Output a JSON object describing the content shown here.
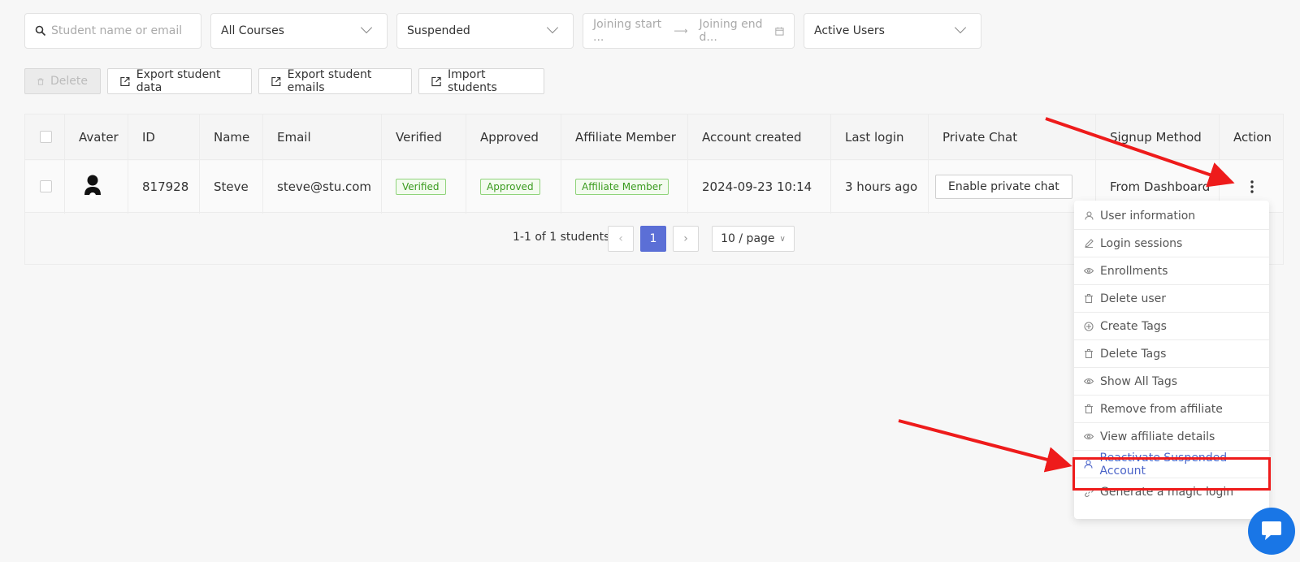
{
  "filters": {
    "search_placeholder": "Student name or email",
    "course": "All Courses",
    "status": "Suspended",
    "date_start_placeholder": "Joining start ...",
    "date_end_placeholder": "Joining end d...",
    "user_type": "Active Users"
  },
  "toolbar": {
    "delete": "Delete",
    "export_data": "Export student data",
    "export_emails": "Export student emails",
    "import": "Import students"
  },
  "table": {
    "headers": [
      "Avater",
      "ID",
      "Name",
      "Email",
      "Verified",
      "Approved",
      "Affiliate Member",
      "Account created",
      "Last login",
      "Private Chat",
      "Signup Method",
      "Action"
    ],
    "row": {
      "id": "817928",
      "name": "Steve",
      "email": "steve@stu.com",
      "verified": "Verified",
      "approved": "Approved",
      "affiliate": "Affiliate Member",
      "created": "2024-09-23 10:14",
      "last_login": "3 hours ago",
      "private_chat": "Enable private chat",
      "signup_method": "From Dashboard"
    }
  },
  "pagination": {
    "summary": "1-1 of 1 students",
    "current_page": "1",
    "page_size": "10 / page"
  },
  "action_menu": {
    "items": [
      {
        "label": "User information",
        "icon": "user-icon"
      },
      {
        "label": "Login sessions",
        "icon": "edit-icon"
      },
      {
        "label": "Enrollments",
        "icon": "eye-icon"
      },
      {
        "label": "Delete user",
        "icon": "trash-icon"
      },
      {
        "label": "Create Tags",
        "icon": "plus-circle-icon"
      },
      {
        "label": "Delete Tags",
        "icon": "trash-icon"
      },
      {
        "label": "Show All Tags",
        "icon": "eye-icon"
      },
      {
        "label": "Remove from affiliate",
        "icon": "trash-icon"
      },
      {
        "label": "View affiliate details",
        "icon": "eye-icon"
      },
      {
        "label": "Reactivate Suspended Account",
        "icon": "user-icon"
      },
      {
        "label": "Generate a magic login",
        "icon": "link-icon"
      }
    ],
    "highlighted": "Reactivate Suspended Account"
  },
  "colors": {
    "accent": "#5b6fd6",
    "annotation_red": "#ee1b1b",
    "tag_green": "#3a9b1f",
    "chat_fab": "#1976e6"
  }
}
